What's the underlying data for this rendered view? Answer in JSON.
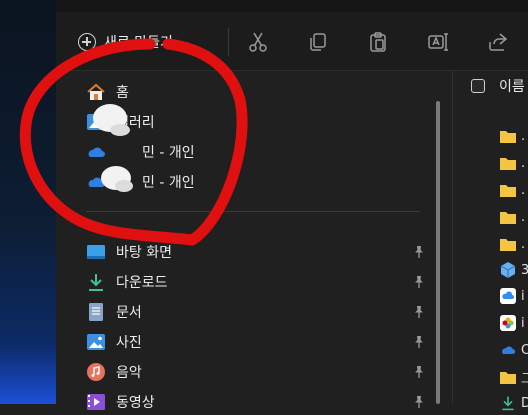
{
  "toolbar": {
    "new_label": "새로 만들기",
    "icons": [
      "cut-icon",
      "copy-icon",
      "paste-icon",
      "rename-icon",
      "share-icon"
    ]
  },
  "nav": {
    "top_items": [
      {
        "label": "홈",
        "icon": "home-icon"
      },
      {
        "label": "갤러리",
        "icon": "gallery-icon"
      },
      {
        "label": "민 - 개인",
        "icon": "onedrive-icon"
      },
      {
        "label": "민 - 개인",
        "icon": "onedrive-icon"
      }
    ],
    "pinned_items": [
      {
        "label": "바탕 화면",
        "icon": "desktop-icon"
      },
      {
        "label": "다운로드",
        "icon": "download-icon"
      },
      {
        "label": "문서",
        "icon": "document-icon"
      },
      {
        "label": "사진",
        "icon": "picture-icon"
      },
      {
        "label": "음악",
        "icon": "music-icon"
      },
      {
        "label": "동영상",
        "icon": "video-icon"
      }
    ]
  },
  "content": {
    "column_name": "이름",
    "rows": [
      {
        "icon": "folder-icon",
        "text": "."
      },
      {
        "icon": "folder-icon",
        "text": "."
      },
      {
        "icon": "folder-icon",
        "text": "."
      },
      {
        "icon": "folder-icon",
        "text": "."
      },
      {
        "icon": "folder-icon",
        "text": "."
      },
      {
        "icon": "3d-objects-icon",
        "text": "3"
      },
      {
        "icon": "icloud-icon",
        "text": "i"
      },
      {
        "icon": "photos-icon",
        "text": "i"
      },
      {
        "icon": "onedrive-icon",
        "text": "C"
      },
      {
        "icon": "folder-icon",
        "text": "그"
      },
      {
        "icon": "download-icon",
        "text": "D"
      }
    ]
  },
  "colors": {
    "accent_folder": "#f4c542",
    "onedrive": "#2f7fe0",
    "annotation": "#e01010",
    "download": "#3ec28f"
  }
}
